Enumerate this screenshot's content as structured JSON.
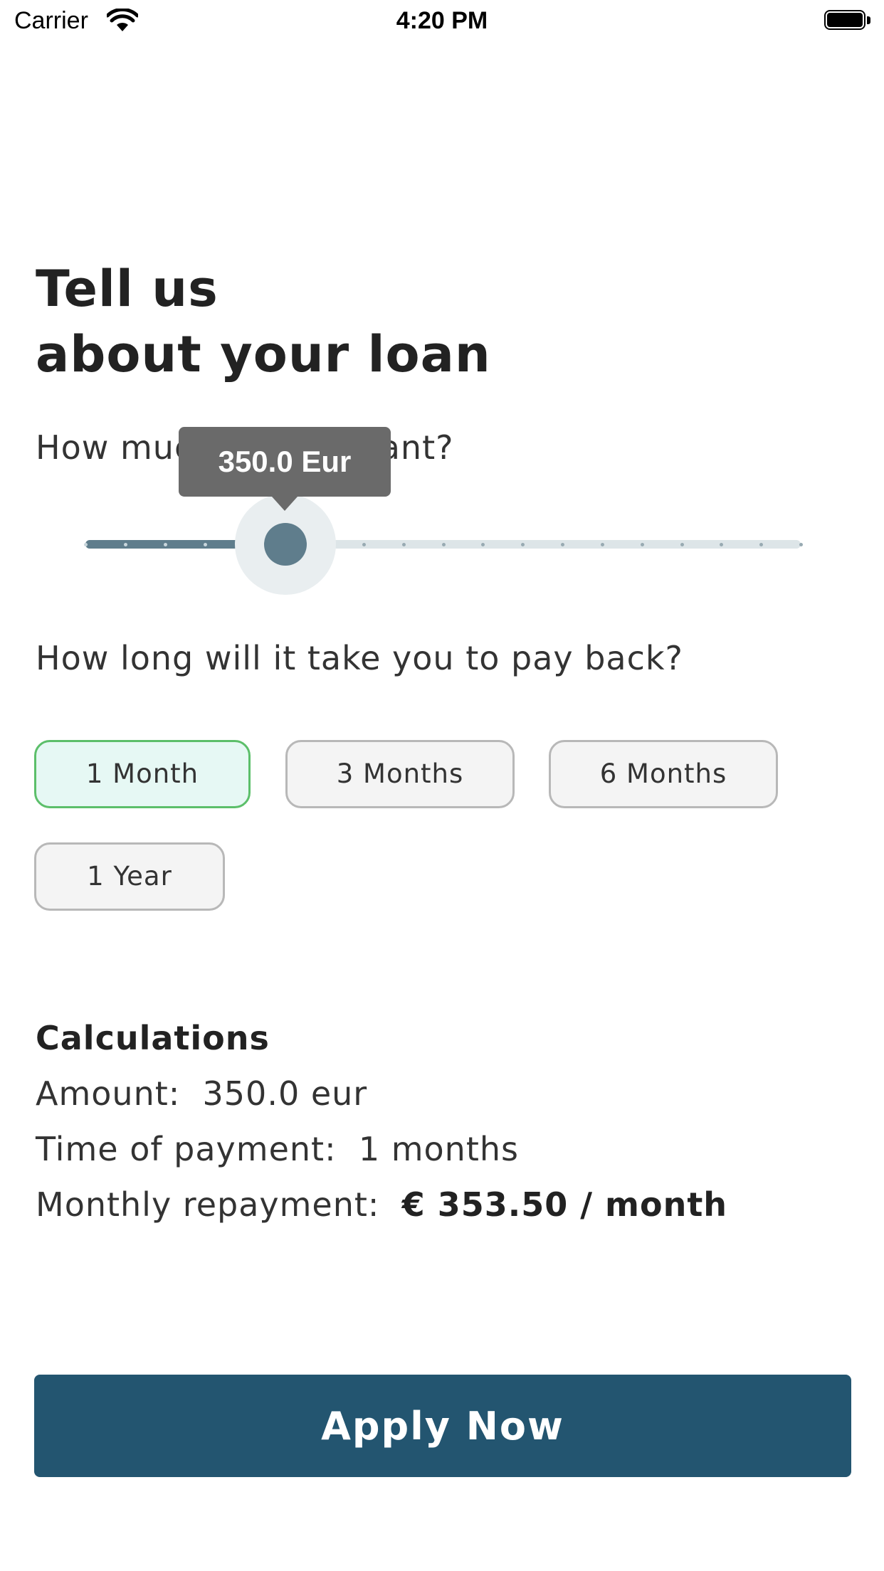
{
  "status_bar": {
    "carrier": "Carrier",
    "time": "4:20 PM"
  },
  "title": {
    "line1": "Tell us",
    "line2": "about your loan"
  },
  "amount_question": "How much do you want?",
  "slider": {
    "tooltip": "350.0 Eur",
    "fraction": 0.28,
    "accent": "#5f7d8c",
    "track_color": "#dde5e8"
  },
  "duration_question": "How long will it take you to pay back?",
  "durations": [
    {
      "label": "1 Month",
      "selected": true
    },
    {
      "label": "3 Months",
      "selected": false
    },
    {
      "label": "6 Months",
      "selected": false
    },
    {
      "label": "1 Year",
      "selected": false
    }
  ],
  "calculations": {
    "heading": "Calculations",
    "amount_label": "Amount:",
    "amount_value": "350.0 eur",
    "time_label": "Time of payment:",
    "time_value": "1 months",
    "monthly_label": "Monthly repayment:",
    "monthly_value": "€ 353.50 / month"
  },
  "apply_button": {
    "label": "Apply Now",
    "color": "#235570"
  },
  "icons": {
    "wifi": "wifi-icon",
    "battery": "battery-icon"
  }
}
